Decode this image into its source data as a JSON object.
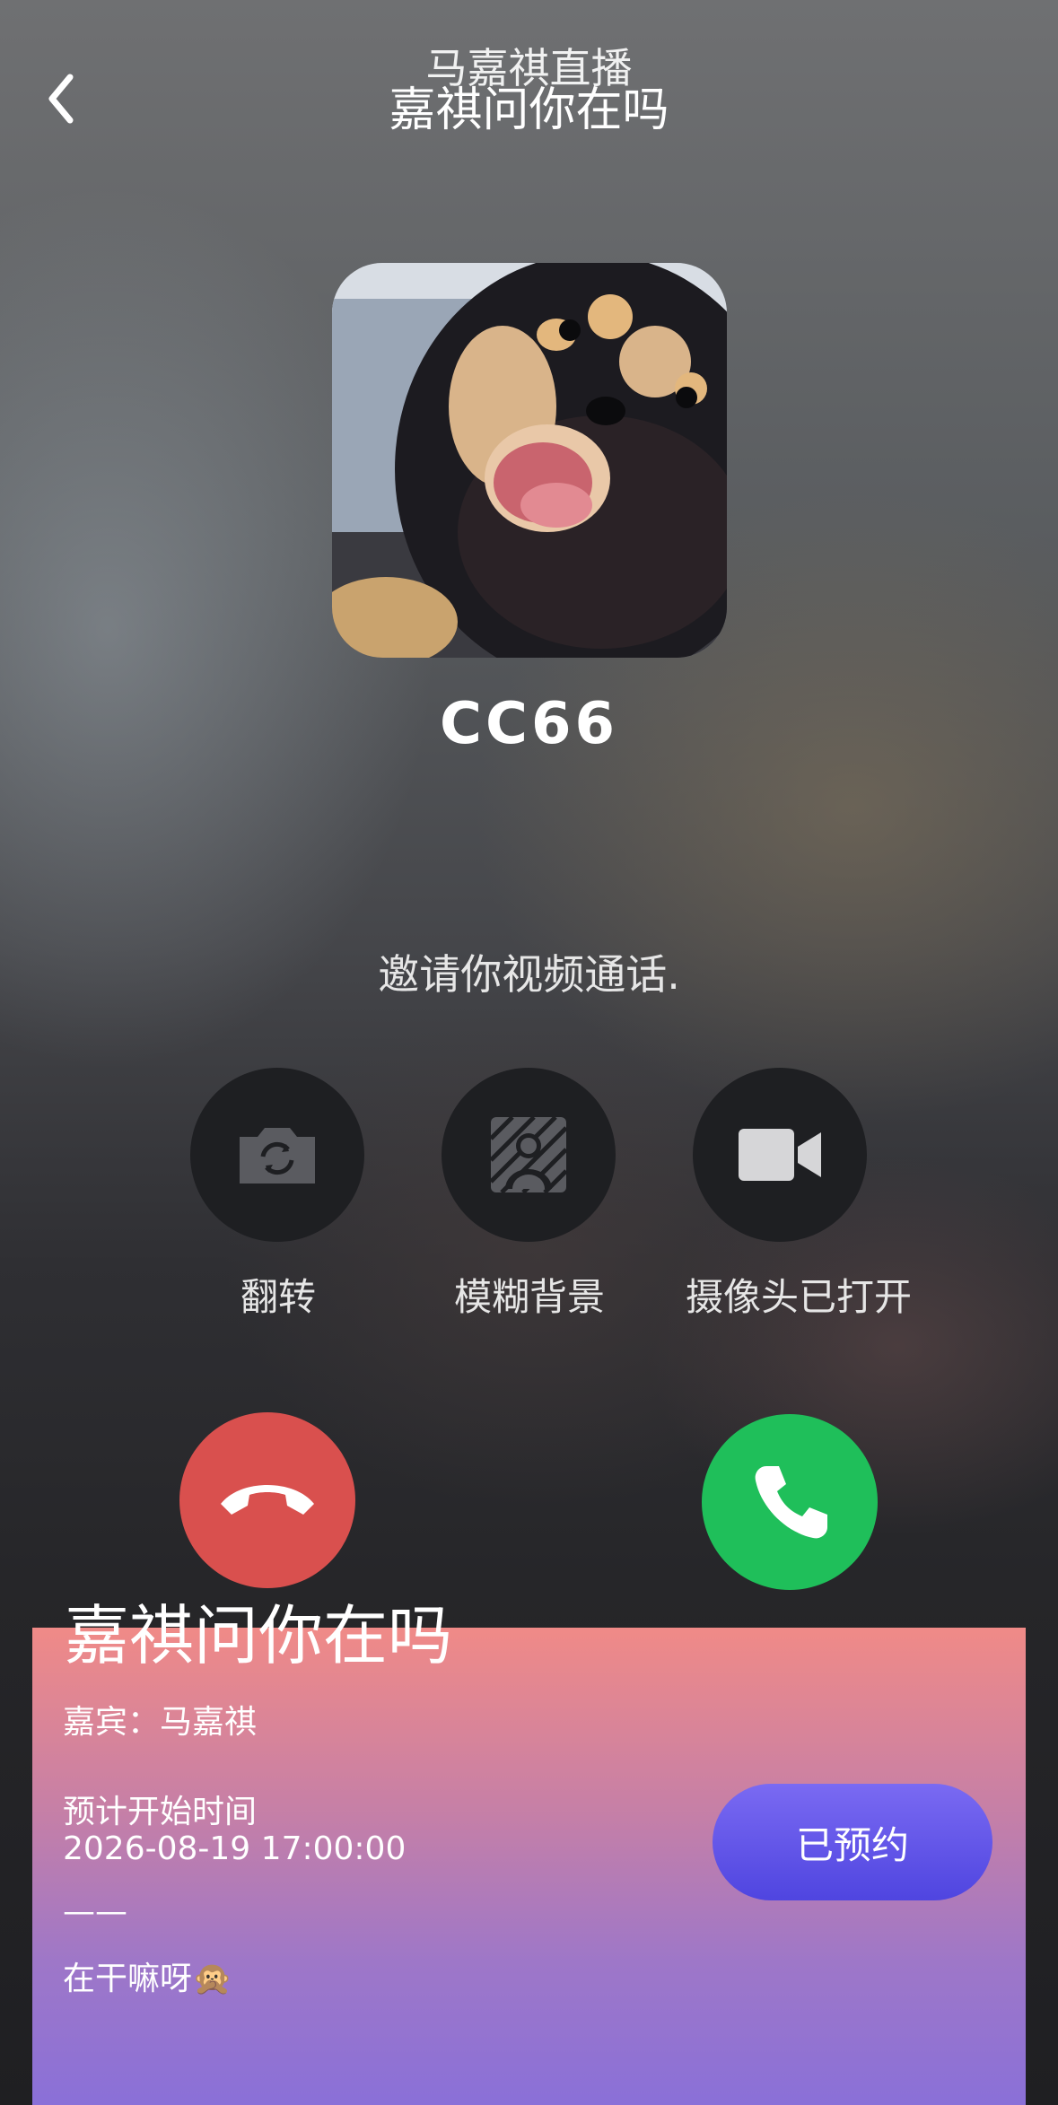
{
  "header": {
    "title_back": "马嘉祺直播",
    "title_front": "嘉祺问你在吗"
  },
  "caller": {
    "name": "CC66",
    "invite": "邀请你视频通话."
  },
  "controls": [
    {
      "label": "翻转",
      "icon": "camera-flip-icon"
    },
    {
      "label": "模糊背景",
      "icon": "blur-background-icon"
    },
    {
      "label": "摄像头已打开",
      "icon": "video-camera-icon"
    }
  ],
  "call_buttons": {
    "decline_icon": "hang-up-icon",
    "accept_icon": "phone-icon",
    "decline_color": "#d9504e",
    "accept_color": "#1fbf5a"
  },
  "card": {
    "title": "嘉祺问你在吗",
    "guest": "嘉宾：马嘉祺",
    "start_label": "预计开始时间",
    "start_time": "2026-08-19 17:00:00",
    "divider": "——",
    "note": "在干嘛呀🙊",
    "reserve_button": "已预约"
  }
}
